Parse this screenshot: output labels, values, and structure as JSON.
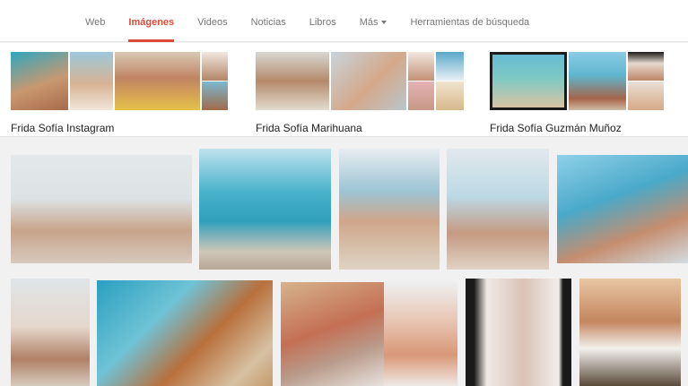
{
  "nav": {
    "tabs": [
      {
        "label": "Web"
      },
      {
        "label": "Imágenes"
      },
      {
        "label": "Videos"
      },
      {
        "label": "Noticias"
      },
      {
        "label": "Libros"
      },
      {
        "label": "Más"
      },
      {
        "label": "Herramientas de búsqueda"
      }
    ],
    "active_color": "#dd4b39"
  },
  "related_searches": [
    {
      "label": "Frida Sofía Instagram"
    },
    {
      "label": "Frida Sofía Marihuana"
    },
    {
      "label": "Frida Sofía Guzmán Muñoz"
    }
  ]
}
